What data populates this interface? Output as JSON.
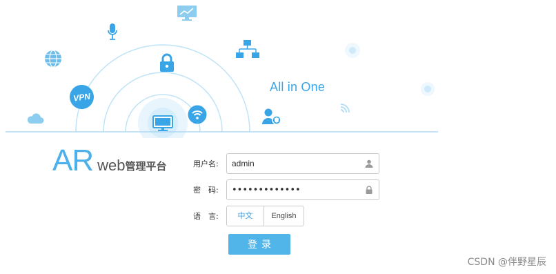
{
  "hero": {
    "tagline": "All in One",
    "vpn_label": "VPN"
  },
  "logo": {
    "main": "AR",
    "web": "web",
    "cn": "管理平台"
  },
  "form": {
    "username_label": "用户名:",
    "username_value": "admin",
    "password_label": "密　码:",
    "password_display": "•••••••••••••",
    "language_label": "语　言:",
    "lang_cn": "中文",
    "lang_en": "English",
    "login_label": "登录"
  },
  "colors": {
    "accent": "#52b5e9",
    "tagline": "#3aa5e6",
    "arc": "#bfe3f7"
  },
  "icons": {
    "username": "user-icon",
    "password": "lock-icon"
  },
  "watermark": "CSDN @伴野星辰"
}
